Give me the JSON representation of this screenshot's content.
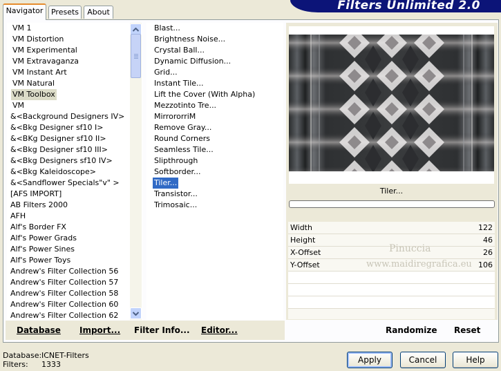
{
  "tabs": [
    {
      "label": "Navigator"
    },
    {
      "label": "Presets"
    },
    {
      "label": "About"
    }
  ],
  "brand": "Filters Unlimited 2.0",
  "categories": [
    "VM 1",
    "VM Distortion",
    "VM Experimental",
    "VM Extravaganza",
    "VM Instant Art",
    "VM Natural",
    "VM Toolbox",
    "VM",
    "&<Background Designers IV>",
    "&<Bkg Designer sf10 I>",
    "&<BKg Designer sf10 II>",
    "&<Bkg Designer sf10 III>",
    "&<Bkg Designers sf10 IV>",
    "&<Bkg Kaleidoscope>",
    "&<Sandflower Specials\"v\" >",
    "[AFS IMPORT]",
    "AB Filters 2000",
    "AFH",
    "Alf's Border FX",
    "Alf's Power Grads",
    "Alf's Power Sines",
    "Alf's Power Toys",
    "Andrew's Filter Collection 56",
    "Andrew's Filter Collection 57",
    "Andrew's Filter Collection 58",
    "Andrew's Filter Collection 60",
    "Andrew's Filter Collection 62"
  ],
  "selected_category": "VM Toolbox",
  "filters": [
    "Blast...",
    "Brightness Noise...",
    "Crystal Ball...",
    "Dynamic Diffusion...",
    "Grid...",
    "Instant Tile...",
    "Lift the Cover (With Alpha)",
    "Mezzotinto Tre...",
    "MirrororriM",
    "Remove Gray...",
    "Round Corners",
    "Seamless Tile...",
    "Slipthrough",
    "Softborder...",
    "Tiler...",
    "Transistor...",
    "Trimosaic..."
  ],
  "selected_filter": "Tiler...",
  "filter_name": "Tiler...",
  "params": [
    {
      "label": "Width",
      "value": "122"
    },
    {
      "label": "Height",
      "value": "46"
    },
    {
      "label": "X-Offset",
      "value": "26"
    },
    {
      "label": "Y-Offset",
      "value": "106"
    }
  ],
  "watermark": {
    "line1": "Pinuccia",
    "line2": "www.maidiregrafica.eu"
  },
  "links": {
    "database": "Database",
    "import": "Import...",
    "filter_info": "Filter Info...",
    "editor": "Editor...",
    "randomize": "Randomize",
    "reset": "Reset"
  },
  "status": {
    "database_label": "Database:",
    "database_value": "ICNET-Filters",
    "filters_label": "Filters:",
    "filters_value": "1333"
  },
  "buttons": {
    "apply": "Apply",
    "cancel": "Cancel",
    "help": "Help"
  },
  "scroll": {
    "position_fraction": 0.0
  }
}
